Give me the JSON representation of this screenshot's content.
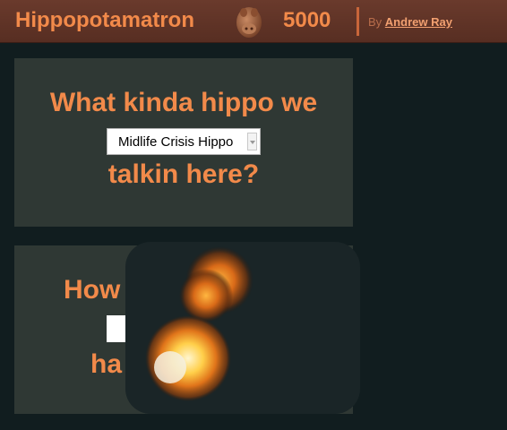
{
  "header": {
    "title": "Hippopotamatron",
    "version": "5000",
    "by_label": "By",
    "author": "Andrew Ray"
  },
  "type_panel": {
    "question_line1": "What kinda hippo we",
    "question_line2": "talkin here?",
    "select_value": "Midlife Crisis Hippo"
  },
  "second_panel": {
    "text_visible_1": "How",
    "text_visible_2": "ha"
  },
  "colors": {
    "accent": "#f28a4a",
    "header_bg": "#5f3326",
    "panel_bg": "#2f3834",
    "page_bg": "#111d1f"
  }
}
